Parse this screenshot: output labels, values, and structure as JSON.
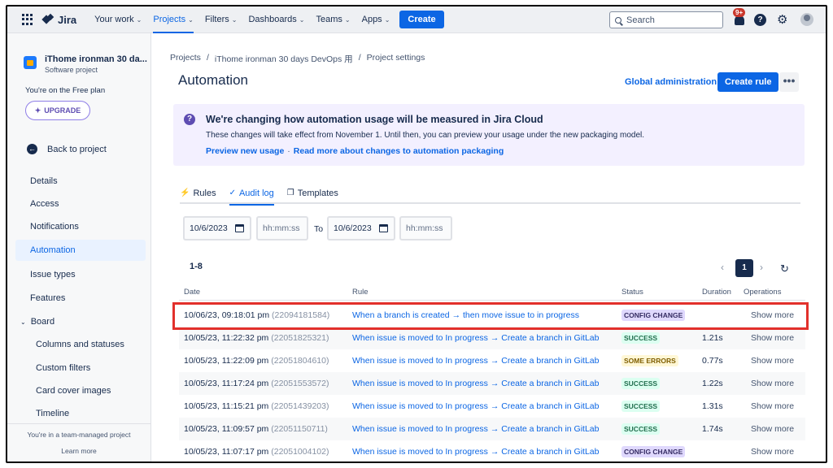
{
  "topnav": {
    "product": "Jira",
    "items": [
      {
        "label": "Your work"
      },
      {
        "label": "Projects"
      },
      {
        "label": "Filters"
      },
      {
        "label": "Dashboards"
      },
      {
        "label": "Teams"
      },
      {
        "label": "Apps"
      }
    ],
    "create_label": "Create",
    "search_placeholder": "Search",
    "notifications_badge": "9+"
  },
  "sidebar": {
    "project_name": "iThome ironman 30 da...",
    "project_type": "Software project",
    "plan_text": "You're on the Free plan",
    "upgrade_label": "UPGRADE",
    "back_label": "Back to project",
    "items": [
      {
        "label": "Details"
      },
      {
        "label": "Access"
      },
      {
        "label": "Notifications"
      },
      {
        "label": "Automation"
      },
      {
        "label": "Issue types"
      },
      {
        "label": "Features"
      },
      {
        "label": "Board"
      },
      {
        "label": "Columns and statuses"
      },
      {
        "label": "Custom filters"
      },
      {
        "label": "Card cover images"
      },
      {
        "label": "Timeline"
      }
    ],
    "footer_text": "You're in a team-managed project",
    "learn_more": "Learn more"
  },
  "main": {
    "breadcrumb": [
      "Projects",
      "iThome ironman 30 days DevOps 用",
      "Project settings"
    ],
    "title": "Automation",
    "global_admin": "Global administration",
    "create_rule": "Create rule",
    "more": "•••",
    "banner": {
      "title": "We're changing how automation usage will be measured in Jira Cloud",
      "text": "These changes will take effect from November 1. Until then, you can preview your usage under the new packaging model.",
      "link1": "Preview new usage",
      "sep": "·",
      "link2": "Read more about changes to automation packaging"
    },
    "tabs": [
      {
        "label": "Rules",
        "icon": "⚡"
      },
      {
        "label": "Audit log",
        "icon": "✓"
      },
      {
        "label": "Templates",
        "icon": "❐"
      }
    ],
    "filters": {
      "from_date": "10/6/2023",
      "from_time_placeholder": "hh:mm:ss",
      "to_label": "To",
      "to_date": "10/6/2023",
      "to_time_placeholder": "hh:mm:ss"
    },
    "result_count": "1-8",
    "pager": {
      "prev": "‹",
      "current": "1",
      "next": "›"
    },
    "columns": [
      "Date",
      "Rule",
      "Status",
      "Duration",
      "Operations"
    ],
    "rows": [
      {
        "date": "10/06/23, 09:18:01 pm",
        "id": "(22094181584)",
        "rule": "When a branch is created → then move issue to in progress",
        "status": "CONFIG CHANGE",
        "duration": "",
        "ops": "Show more"
      },
      {
        "date": "10/05/23, 11:22:32 pm",
        "id": "(22051825321)",
        "rule": "When issue is moved to In progress → Create a branch in GitLab",
        "status": "SUCCESS",
        "duration": "1.21s",
        "ops": "Show more"
      },
      {
        "date": "10/05/23, 11:22:09 pm",
        "id": "(22051804610)",
        "rule": "When issue is moved to In progress → Create a branch in GitLab",
        "status": "SOME ERRORS",
        "duration": "0.77s",
        "ops": "Show more"
      },
      {
        "date": "10/05/23, 11:17:24 pm",
        "id": "(22051553572)",
        "rule": "When issue is moved to In progress → Create a branch in GitLab",
        "status": "SUCCESS",
        "duration": "1.22s",
        "ops": "Show more"
      },
      {
        "date": "10/05/23, 11:15:21 pm",
        "id": "(22051439203)",
        "rule": "When issue is moved to In progress → Create a branch in GitLab",
        "status": "SUCCESS",
        "duration": "1.31s",
        "ops": "Show more"
      },
      {
        "date": "10/05/23, 11:09:57 pm",
        "id": "(22051150711)",
        "rule": "When issue is moved to In progress → Create a branch in GitLab",
        "status": "SUCCESS",
        "duration": "1.74s",
        "ops": "Show more"
      },
      {
        "date": "10/05/23, 11:07:17 pm",
        "id": "(22051004102)",
        "rule": "When issue is moved to In progress → Create a branch in GitLab",
        "status": "CONFIG CHANGE",
        "duration": "",
        "ops": "Show more"
      }
    ]
  },
  "colors": {
    "accent": "#0c66e4",
    "highlight": "#e2302b",
    "config": "#dfd8fd",
    "success": "#dcfff1",
    "errors": "#fff7d6"
  }
}
